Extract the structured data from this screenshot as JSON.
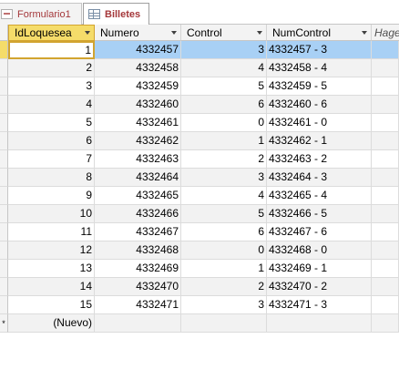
{
  "tabs": [
    {
      "label": "Formulario1",
      "icon": "form-icon",
      "active": false
    },
    {
      "label": "Billetes",
      "icon": "table-icon",
      "active": true
    }
  ],
  "columns": [
    {
      "label": "IdLoquesea",
      "align": "right"
    },
    {
      "label": "Numero",
      "align": "right"
    },
    {
      "label": "Control",
      "align": "right"
    },
    {
      "label": "NumControl",
      "align": "left"
    },
    {
      "label": "Hage",
      "align": "left"
    }
  ],
  "rows": [
    [
      "1",
      "4332457",
      "3",
      "4332457 - 3"
    ],
    [
      "2",
      "4332458",
      "4",
      "4332458 - 4"
    ],
    [
      "3",
      "4332459",
      "5",
      "4332459 - 5"
    ],
    [
      "4",
      "4332460",
      "6",
      "4332460 - 6"
    ],
    [
      "5",
      "4332461",
      "0",
      "4332461 - 0"
    ],
    [
      "6",
      "4332462",
      "1",
      "4332462 - 1"
    ],
    [
      "7",
      "4332463",
      "2",
      "4332463 - 2"
    ],
    [
      "8",
      "4332464",
      "3",
      "4332464 - 3"
    ],
    [
      "9",
      "4332465",
      "4",
      "4332465 - 4"
    ],
    [
      "10",
      "4332466",
      "5",
      "4332466 - 5"
    ],
    [
      "11",
      "4332467",
      "6",
      "4332467 - 6"
    ],
    [
      "12",
      "4332468",
      "0",
      "4332468 - 0"
    ],
    [
      "13",
      "4332469",
      "1",
      "4332469 - 1"
    ],
    [
      "14",
      "4332470",
      "2",
      "4332470 - 2"
    ],
    [
      "15",
      "4332471",
      "3",
      "4332471 - 3"
    ]
  ],
  "new_row": {
    "label": "(Nuevo)",
    "marker": "*"
  },
  "colors": {
    "accent": "#f5dc6a",
    "selection": "#a8d0f5",
    "tab_text": "#a4373a"
  }
}
